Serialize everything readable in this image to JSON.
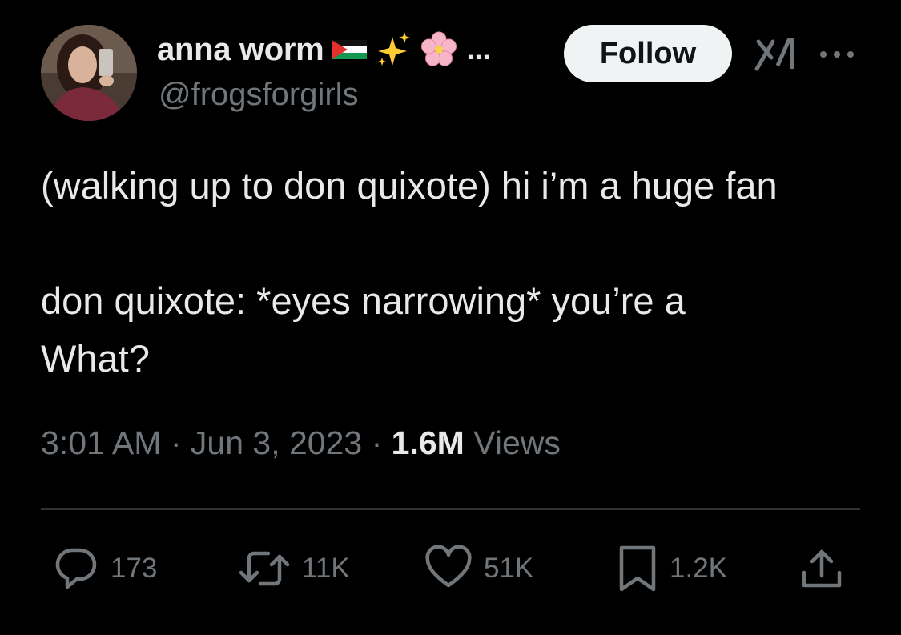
{
  "author": {
    "display_name": "anna worm",
    "handle": "@frogsforgirls",
    "name_emojis": [
      "palestine-flag",
      "sparkles",
      "cherry-blossom"
    ],
    "name_truncation": "..."
  },
  "header": {
    "follow_label": "Follow",
    "grok_icon": "grok-icon",
    "more_icon": "more-dots-icon"
  },
  "tweet": {
    "text": "(walking up to don quixote) hi i’m a huge fan\n\ndon quixote: *eyes narrowing* you’re a\nWhat?"
  },
  "meta": {
    "time": "3:01 AM",
    "separator": "·",
    "date": "Jun 3, 2023",
    "views_count": "1.6M",
    "views_label": "Views"
  },
  "actions": {
    "replies": "173",
    "reposts": "11K",
    "likes": "51K",
    "bookmarks": "1.2K"
  },
  "colors": {
    "background": "#000000",
    "text_primary": "#e7e9ea",
    "text_secondary": "#71767b",
    "divider": "#2f3336",
    "follow_bg": "#eff3f4"
  }
}
